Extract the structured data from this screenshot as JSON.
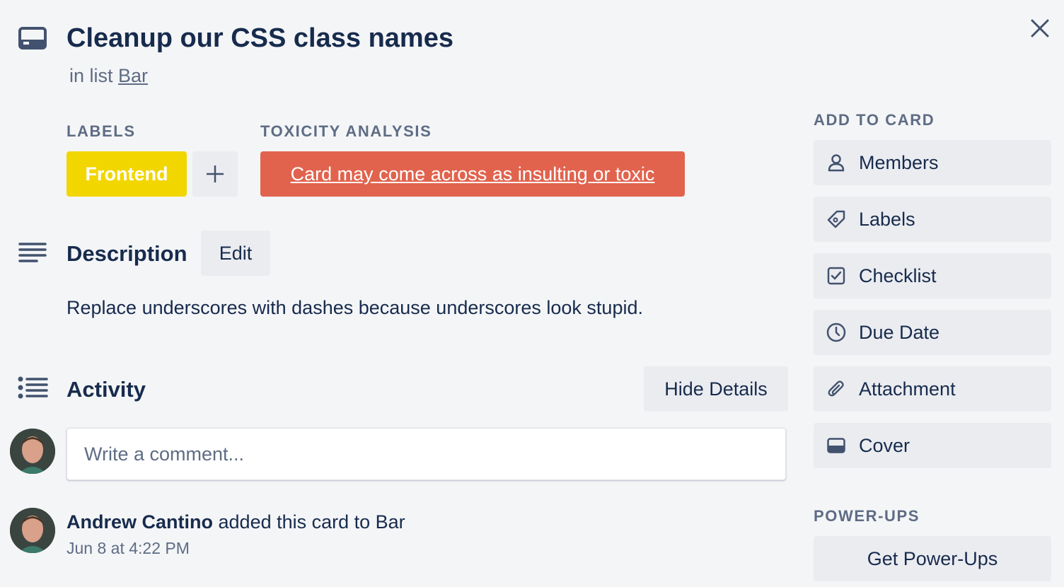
{
  "card": {
    "title": "Cleanup our CSS class names",
    "in_list_prefix": "in list",
    "list_name": "Bar"
  },
  "labels": {
    "heading": "LABELS",
    "items": [
      {
        "name": "Frontend",
        "color": "#f2d600"
      }
    ],
    "add_symbol": "+"
  },
  "toxicity": {
    "heading": "TOXICITY ANALYSIS",
    "message": "Card may come across as insulting or toxic",
    "color": "#e1634e"
  },
  "description": {
    "heading": "Description",
    "edit_label": "Edit",
    "text": "Replace underscores with dashes because underscores look stupid."
  },
  "activity": {
    "heading": "Activity",
    "hide_details_label": "Hide Details",
    "comment_placeholder": "Write a comment...",
    "entries": [
      {
        "user": "Andrew Cantino",
        "action": "added this card to Bar",
        "time": "Jun 8 at 4:22 PM"
      }
    ]
  },
  "sidebar": {
    "add_to_card_heading": "ADD TO CARD",
    "buttons": [
      {
        "label": "Members",
        "icon": "person-icon"
      },
      {
        "label": "Labels",
        "icon": "tag-icon"
      },
      {
        "label": "Checklist",
        "icon": "checkbox-icon"
      },
      {
        "label": "Due Date",
        "icon": "clock-icon"
      },
      {
        "label": "Attachment",
        "icon": "paperclip-icon"
      },
      {
        "label": "Cover",
        "icon": "cover-icon"
      }
    ],
    "powerups_heading": "POWER-UPS",
    "get_powerups_label": "Get Power-Ups"
  },
  "colors": {
    "background": "#f4f5f7",
    "button_bg": "#ebecf0",
    "text_primary": "#172b4d",
    "text_subtle": "#5e6c84"
  }
}
